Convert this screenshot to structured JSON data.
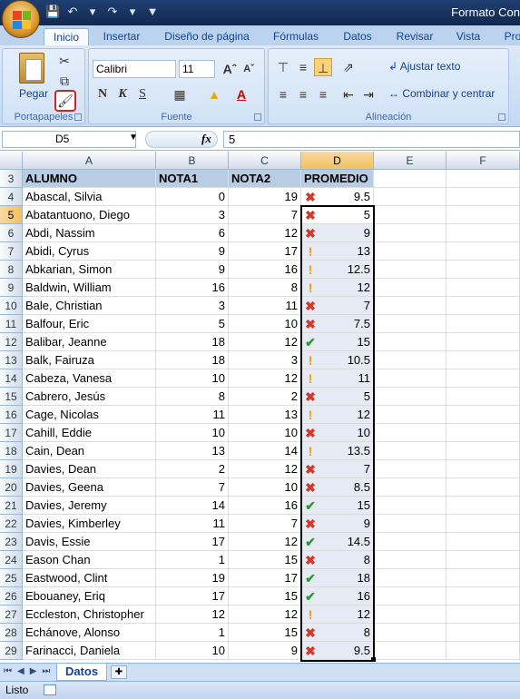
{
  "title": "Formato Con",
  "quick_access": {
    "save_icon": "save-icon",
    "undo_icon": "undo-icon",
    "redo_icon": "redo-icon"
  },
  "ribbon_tabs": [
    "Inicio",
    "Insertar",
    "Diseño de página",
    "Fórmulas",
    "Datos",
    "Revisar",
    "Vista",
    "Pro"
  ],
  "clipboard": {
    "paste_label": "Pegar",
    "group_label": "Portapapeles"
  },
  "font": {
    "name": "Calibri",
    "size": "11",
    "group_label": "Fuente",
    "bold": "N",
    "italic": "K",
    "underline": "S"
  },
  "alignment": {
    "wrap_label": "Ajustar texto",
    "merge_label": "Combinar y centrar",
    "group_label": "Alineación"
  },
  "formula_bar": {
    "name_box": "D5",
    "fx": "fx",
    "value": "5"
  },
  "columns": [
    "A",
    "B",
    "C",
    "D",
    "E",
    "F"
  ],
  "headers": {
    "alumno": "ALUMNO",
    "nota1": "NOTA1",
    "nota2": "NOTA2",
    "promedio": "PROMEDIO"
  },
  "rows": [
    {
      "row": "4",
      "name": "Abascal, Silvia",
      "n1": "0",
      "n2": "19",
      "status": "bad",
      "prom": "9.5"
    },
    {
      "row": "5",
      "name": "Abatantuono, Diego",
      "n1": "3",
      "n2": "7",
      "status": "bad",
      "prom": "5"
    },
    {
      "row": "6",
      "name": "Abdi, Nassim",
      "n1": "6",
      "n2": "12",
      "status": "bad",
      "prom": "9"
    },
    {
      "row": "7",
      "name": "Abidi, Cyrus",
      "n1": "9",
      "n2": "17",
      "status": "warn",
      "prom": "13"
    },
    {
      "row": "8",
      "name": "Abkarian, Simon",
      "n1": "9",
      "n2": "16",
      "status": "warn",
      "prom": "12.5"
    },
    {
      "row": "9",
      "name": "Baldwin, William",
      "n1": "16",
      "n2": "8",
      "status": "warn",
      "prom": "12"
    },
    {
      "row": "10",
      "name": "Bale, Christian",
      "n1": "3",
      "n2": "11",
      "status": "bad",
      "prom": "7"
    },
    {
      "row": "11",
      "name": "Balfour, Eric",
      "n1": "5",
      "n2": "10",
      "status": "bad",
      "prom": "7.5"
    },
    {
      "row": "12",
      "name": "Balibar, Jeanne",
      "n1": "18",
      "n2": "12",
      "status": "ok",
      "prom": "15"
    },
    {
      "row": "13",
      "name": "Balk, Fairuza",
      "n1": "18",
      "n2": "3",
      "status": "warn",
      "prom": "10.5"
    },
    {
      "row": "14",
      "name": "Cabeza, Vanesa",
      "n1": "10",
      "n2": "12",
      "status": "warn",
      "prom": "11"
    },
    {
      "row": "15",
      "name": "Cabrero, Jesús",
      "n1": "8",
      "n2": "2",
      "status": "bad",
      "prom": "5"
    },
    {
      "row": "16",
      "name": "Cage, Nicolas",
      "n1": "11",
      "n2": "13",
      "status": "warn",
      "prom": "12"
    },
    {
      "row": "17",
      "name": "Cahill, Eddie",
      "n1": "10",
      "n2": "10",
      "status": "bad",
      "prom": "10"
    },
    {
      "row": "18",
      "name": "Cain, Dean",
      "n1": "13",
      "n2": "14",
      "status": "warn",
      "prom": "13.5"
    },
    {
      "row": "19",
      "name": "Davies, Dean",
      "n1": "2",
      "n2": "12",
      "status": "bad",
      "prom": "7"
    },
    {
      "row": "20",
      "name": "Davies, Geena",
      "n1": "7",
      "n2": "10",
      "status": "bad",
      "prom": "8.5"
    },
    {
      "row": "21",
      "name": "Davies, Jeremy",
      "n1": "14",
      "n2": "16",
      "status": "ok",
      "prom": "15"
    },
    {
      "row": "22",
      "name": "Davies, Kimberley",
      "n1": "11",
      "n2": "7",
      "status": "bad",
      "prom": "9"
    },
    {
      "row": "23",
      "name": "Davis, Essie",
      "n1": "17",
      "n2": "12",
      "status": "ok",
      "prom": "14.5"
    },
    {
      "row": "24",
      "name": "Eason Chan",
      "n1": "1",
      "n2": "15",
      "status": "bad",
      "prom": "8"
    },
    {
      "row": "25",
      "name": "Eastwood, Clint",
      "n1": "19",
      "n2": "17",
      "status": "ok",
      "prom": "18"
    },
    {
      "row": "26",
      "name": "Ebouaney, Eriq",
      "n1": "17",
      "n2": "15",
      "status": "ok",
      "prom": "16"
    },
    {
      "row": "27",
      "name": "Eccleston, Christopher",
      "n1": "12",
      "n2": "12",
      "status": "warn",
      "prom": "12"
    },
    {
      "row": "28",
      "name": "Echánove, Alonso",
      "n1": "1",
      "n2": "15",
      "status": "bad",
      "prom": "8"
    },
    {
      "row": "29",
      "name": "Farinacci, Daniela",
      "n1": "10",
      "n2": "9",
      "status": "bad",
      "prom": "9.5"
    }
  ],
  "sheet_tab": "Datos",
  "status_text": "Listo",
  "colors": {
    "accent": "#f1c15f",
    "ok": "#2b9a2b",
    "bad": "#d23a2a",
    "warn": "#f0a000"
  }
}
